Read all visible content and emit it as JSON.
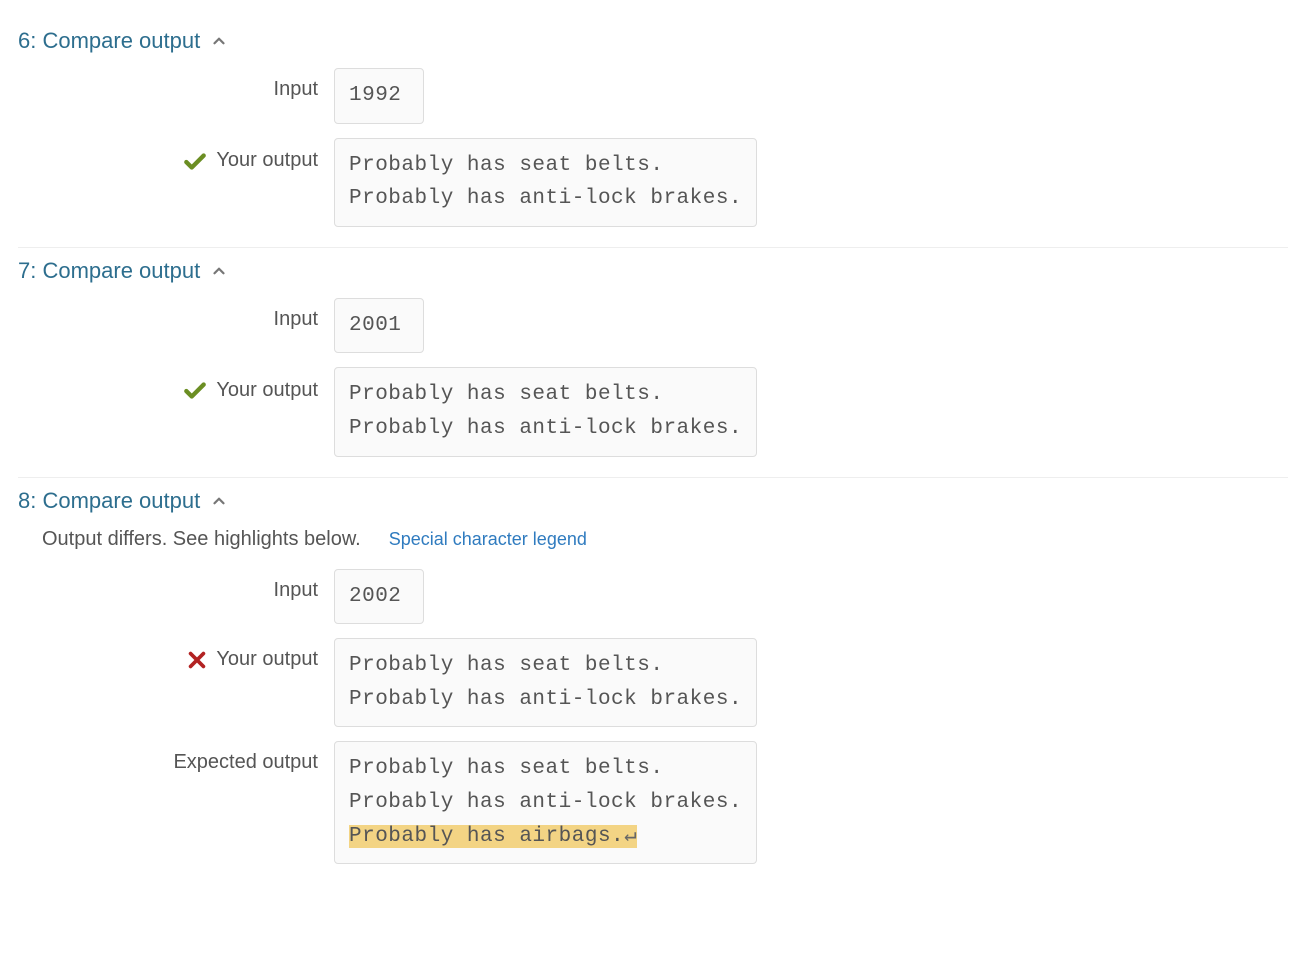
{
  "labels": {
    "input": "Input",
    "your_output": "Your output",
    "expected_output": "Expected output",
    "output_differs": "Output differs. See highlights below.",
    "special_legend": "Special character legend"
  },
  "sections": [
    {
      "header": "6: Compare output",
      "status": "pass",
      "input": "1992",
      "your_output": "Probably has seat belts.\nProbably has anti-lock brakes.",
      "expected_output": null,
      "differs": false
    },
    {
      "header": "7: Compare output",
      "status": "pass",
      "input": "2001",
      "your_output": "Probably has seat belts.\nProbably has anti-lock brakes.",
      "expected_output": null,
      "differs": false
    },
    {
      "header": "8: Compare output",
      "status": "fail",
      "input": "2002",
      "your_output": "Probably has seat belts.\nProbably has anti-lock brakes.",
      "expected_output": null,
      "expected_lines": [
        {
          "text": "Probably has seat belts.",
          "hl": false,
          "ret": false
        },
        {
          "text": "Probably has anti-lock brakes.",
          "hl": false,
          "ret": false
        },
        {
          "text": "Probably has airbags.",
          "hl": true,
          "ret": true
        }
      ],
      "differs": true
    }
  ]
}
